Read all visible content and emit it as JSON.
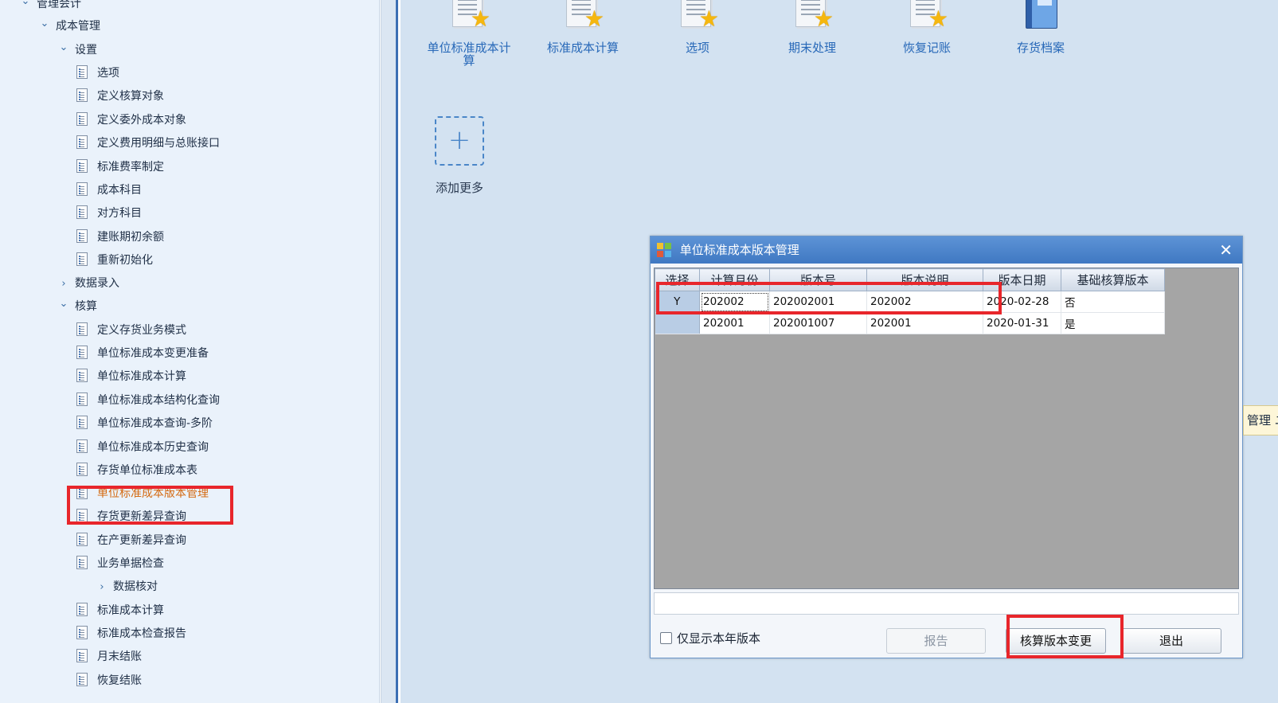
{
  "tree": {
    "items": [
      {
        "label": "管理会计",
        "type": "folder",
        "expanded": true
      },
      {
        "label": "成本管理",
        "type": "folder",
        "expanded": true
      },
      {
        "label": "设置",
        "type": "folder",
        "expanded": true
      },
      {
        "label": "选项",
        "type": "leaf"
      },
      {
        "label": "定义核算对象",
        "type": "leaf"
      },
      {
        "label": "定义委外成本对象",
        "type": "leaf"
      },
      {
        "label": "定义费用明细与总账接口",
        "type": "leaf"
      },
      {
        "label": "标准费率制定",
        "type": "leaf"
      },
      {
        "label": "成本科目",
        "type": "leaf"
      },
      {
        "label": "对方科目",
        "type": "leaf"
      },
      {
        "label": "建账期初余额",
        "type": "leaf"
      },
      {
        "label": "重新初始化",
        "type": "leaf"
      },
      {
        "label": "数据录入",
        "type": "folder",
        "expanded": false
      },
      {
        "label": "核算",
        "type": "folder",
        "expanded": true
      },
      {
        "label": "定义存货业务模式",
        "type": "leaf"
      },
      {
        "label": "单位标准成本变更准备",
        "type": "leaf"
      },
      {
        "label": "单位标准成本计算",
        "type": "leaf"
      },
      {
        "label": "单位标准成本结构化查询",
        "type": "leaf"
      },
      {
        "label": "单位标准成本查询-多阶",
        "type": "leaf"
      },
      {
        "label": "单位标准成本历史查询",
        "type": "leaf"
      },
      {
        "label": "存货单位标准成本表",
        "type": "leaf"
      },
      {
        "label": "单位标准成本版本管理",
        "type": "leaf",
        "active": true
      },
      {
        "label": "存货更新差异查询",
        "type": "leaf"
      },
      {
        "label": "在产更新差异查询",
        "type": "leaf"
      },
      {
        "label": "业务单据检查",
        "type": "leaf"
      },
      {
        "label": "数据核对",
        "type": "folder",
        "expanded": false
      },
      {
        "label": "标准成本计算",
        "type": "leaf"
      },
      {
        "label": "标准成本检查报告",
        "type": "leaf"
      },
      {
        "label": "月末结账",
        "type": "leaf"
      },
      {
        "label": "恢复结账",
        "type": "leaf"
      }
    ]
  },
  "quick_icons": [
    {
      "label": "单位标准成本计算",
      "icon": "document-star-icon"
    },
    {
      "label": "标准成本计算",
      "icon": "document-star-icon"
    },
    {
      "label": "选项",
      "icon": "document-star-icon"
    },
    {
      "label": "期末处理",
      "icon": "document-star-icon"
    },
    {
      "label": "恢复记账",
      "icon": "document-star-icon"
    },
    {
      "label": "存货档案",
      "icon": "book-icon"
    }
  ],
  "add_more_label": "添加更多",
  "dialog": {
    "title": "单位标准成本版本管理",
    "columns": [
      "选择",
      "计算月份",
      "版本号",
      "版本说明",
      "版本日期",
      "基础核算版本"
    ],
    "rows": [
      {
        "select": "Y",
        "month": "202002",
        "version": "202002001",
        "desc": "202002",
        "date": "2020-02-28",
        "base": "否"
      },
      {
        "select": "",
        "month": "202001",
        "version": "202001007",
        "desc": "202001",
        "date": "2020-01-31",
        "base": "是"
      }
    ],
    "checkbox_label": "仅显示本年版本",
    "buttons": {
      "report": "报告",
      "change": "核算版本变更",
      "exit": "退出"
    }
  },
  "side_tip": "管理 ユ",
  "colors": {
    "highlight": "#e8262b",
    "title_bar": "#4a82c9",
    "active_item": "#d46a12"
  }
}
